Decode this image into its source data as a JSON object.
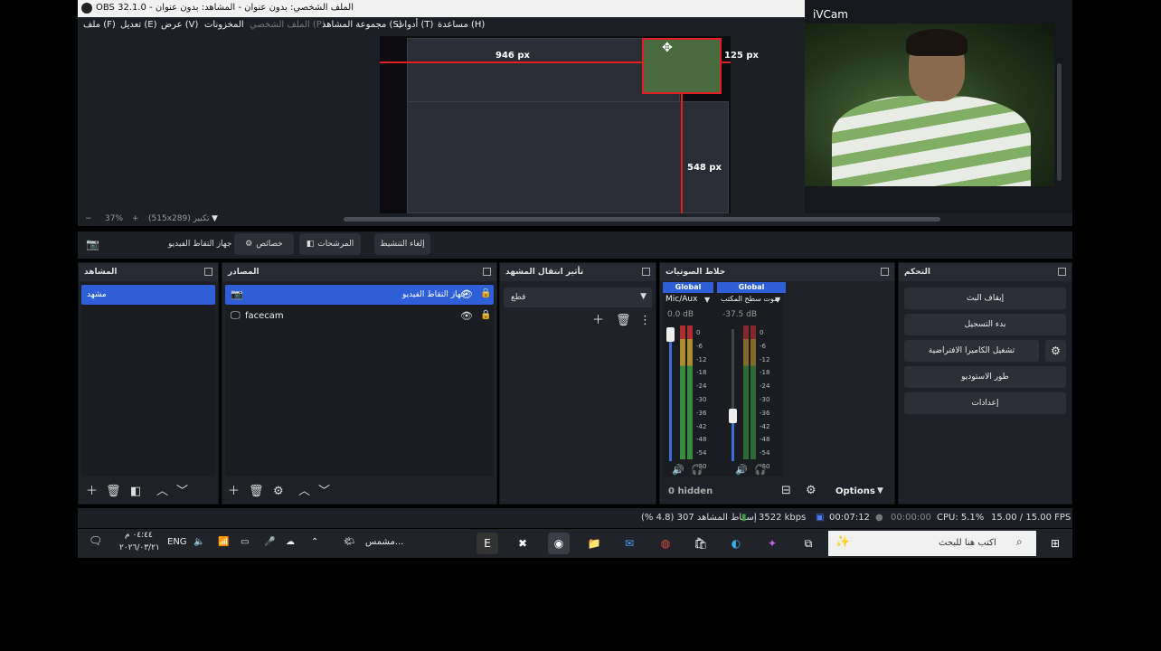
{
  "window": {
    "title": "OBS 32.1.0 - الملف الشخصي: بدون عنوان - المشاهد: بدون عنوان"
  },
  "menu": [
    "ملف (F)",
    "تعديل (E)",
    "عرض (V)",
    "المخزونات",
    "الملف الشخصي (P)",
    "مجموعة المشاهد (S)",
    "أدوات (T)",
    "مساعدة (H)"
  ],
  "preview": {
    "dim1": "946 px",
    "dim2": "125 px",
    "dim3": "548 px",
    "zoom": "37%",
    "zoom_label": "(515x289) تكبير"
  },
  "ivcam": {
    "label": "iVCam"
  },
  "source_toolbar": {
    "source_name": "جهاز التقاط الفيديو",
    "properties": "خصائص",
    "filters": "المرشحات",
    "deactivate": "إلغاء التنشيط"
  },
  "scenes": {
    "title": "المشاهد",
    "items": [
      "مشهد"
    ]
  },
  "sources": {
    "title": "المصادر",
    "items": [
      "جهاز التقاط الفيديو",
      "facecam"
    ]
  },
  "transitions": {
    "title": "تأثير انتقال المشهد",
    "selected": "قطع"
  },
  "mixer": {
    "title": "خلاط الصوتيات",
    "channels": [
      {
        "tag": "Global",
        "name": "Mic/Aux",
        "db": "0.0 dB"
      },
      {
        "tag": "Global",
        "name": "صوت سطح المكتب",
        "db": "-37.5 dB"
      }
    ],
    "scale": [
      "0",
      "-6",
      "-12",
      "-18",
      "-24",
      "-30",
      "-36",
      "-42",
      "-48",
      "-54",
      "-60"
    ],
    "hidden": "0 hidden",
    "options": "Options"
  },
  "controls": {
    "title": "التحكم",
    "buttons": [
      "إيقاف البث",
      "بدء التسجيل",
      "تشغيل الكاميرا الافتراضية",
      "طور الاستوديو",
      "إعدادات"
    ]
  },
  "status": {
    "dropped": "إسقاط المشاهد 307 (4.8 %)",
    "bitrate": "3522 kbps",
    "stream_time": "00:07:12",
    "rec_time": "00:00:00",
    "cpu": "CPU: 5.1%",
    "fps": "15.00 / 15.00 FPS"
  },
  "taskbar": {
    "time": "٠٤:٤٤ م",
    "date": "٢٠٢٦/٠٣/٢١",
    "lang": "ENG",
    "weather": "مشمس...",
    "search_placeholder": "اكتب هنا للبحث"
  },
  "colors": {
    "accent": "#2e5fd8",
    "panel": "#1f2129",
    "red": "#e02020"
  }
}
